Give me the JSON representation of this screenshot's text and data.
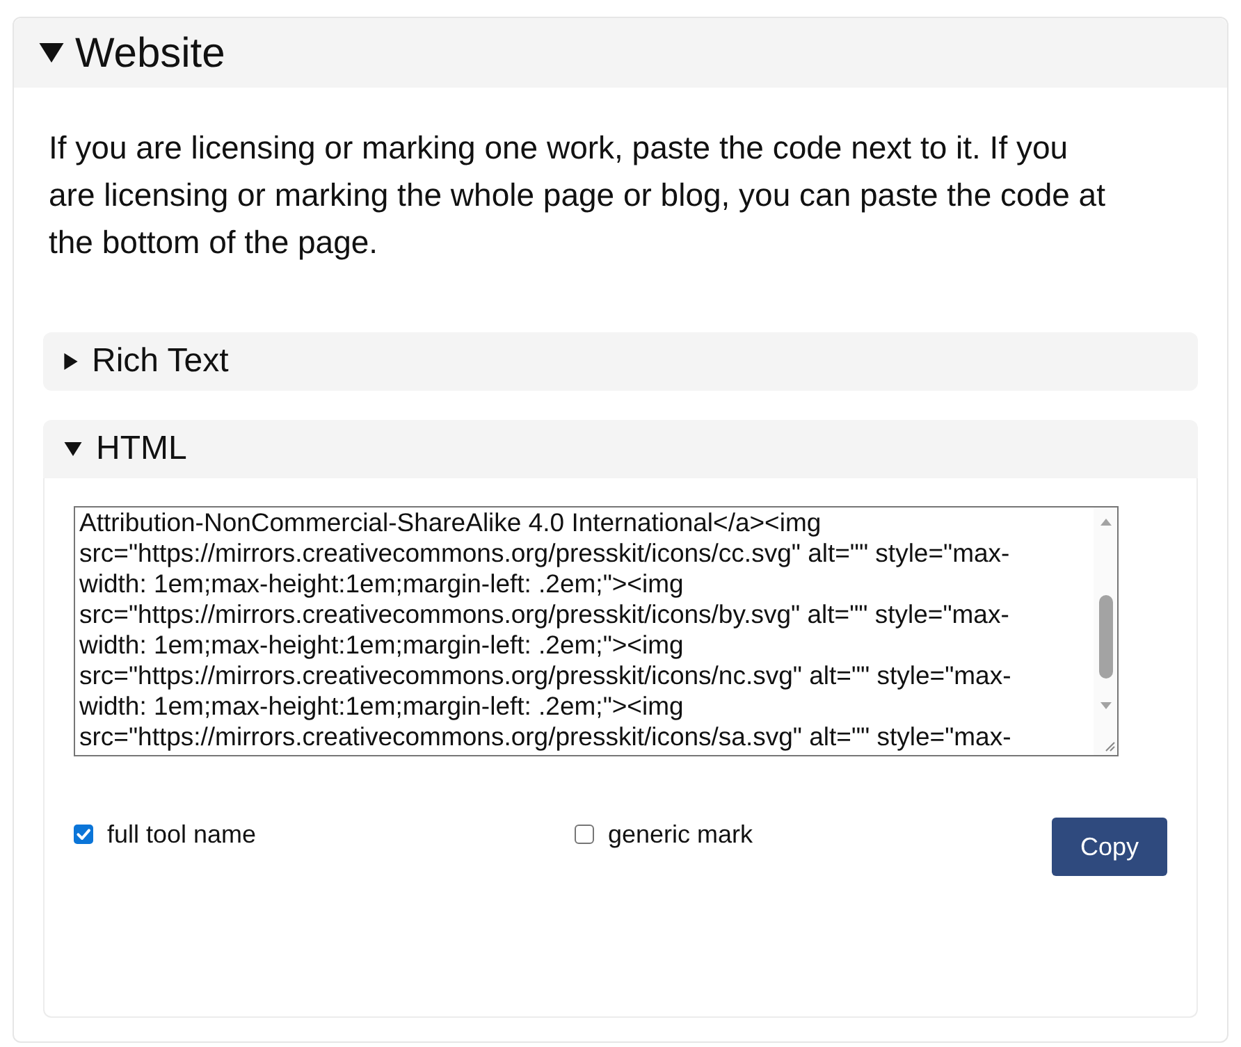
{
  "section": {
    "title": "Website",
    "expanded": true,
    "description": "If you are licensing or marking one work, paste the code next to it. If you are licensing or marking the whole page or blog, you can paste the code at the bottom of the page.",
    "subsections": [
      {
        "title": "Rich Text",
        "expanded": false
      },
      {
        "title": "HTML",
        "expanded": true,
        "code_lines": [
          "Attribution-NonCommercial-ShareAlike 4.0 International</a><img",
          "src=\"https://mirrors.creativecommons.org/presskit/icons/cc.svg\" alt=\"\" style=\"max-",
          "width: 1em;max-height:1em;margin-left: .2em;\"><img",
          "src=\"https://mirrors.creativecommons.org/presskit/icons/by.svg\" alt=\"\" style=\"max-",
          "width: 1em;max-height:1em;margin-left: .2em;\"><img",
          "src=\"https://mirrors.creativecommons.org/presskit/icons/nc.svg\" alt=\"\" style=\"max-",
          "width: 1em;max-height:1em;margin-left: .2em;\"><img",
          "src=\"https://mirrors.creativecommons.org/presskit/icons/sa.svg\" alt=\"\" style=\"max-"
        ],
        "options": [
          {
            "label": "full tool name",
            "checked": true
          },
          {
            "label": "generic mark",
            "checked": false
          }
        ],
        "button": "Copy"
      }
    ]
  }
}
